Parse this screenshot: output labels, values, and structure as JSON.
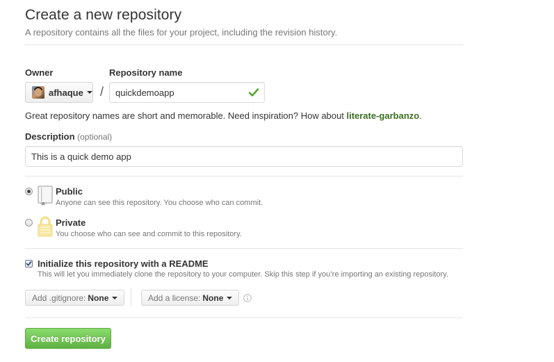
{
  "header": {
    "title": "Create a new repository",
    "subtitle": "A repository contains all the files for your project, including the revision history."
  },
  "owner": {
    "label": "Owner",
    "name": "afhaque"
  },
  "separator": "/",
  "repo_name": {
    "label": "Repository name",
    "value": "quickdemoapp",
    "valid_icon": "check-icon"
  },
  "hint": {
    "text": "Great repository names are short and memorable. Need inspiration? How about ",
    "suggestion": "literate-garbanzo",
    "end": "."
  },
  "description": {
    "label": "Description",
    "optional": "(optional)",
    "value": "This is a quick demo app"
  },
  "visibility": {
    "selected": "public",
    "public": {
      "title": "Public",
      "desc": "Anyone can see this repository. You choose who can commit.",
      "icon": "repo-book-icon"
    },
    "private": {
      "title": "Private",
      "desc": "You choose who can see and commit to this repository.",
      "icon": "lock-icon"
    }
  },
  "readme": {
    "checked": true,
    "title": "Initialize this repository with a README",
    "desc": "This will let you immediately clone the repository to your computer. Skip this step if you’re importing an existing repository."
  },
  "gitignore": {
    "label": "Add .gitignore:",
    "value": "None"
  },
  "license": {
    "label": "Add a license:",
    "value": "None"
  },
  "submit": {
    "label": "Create repository"
  },
  "colors": {
    "accent_green": "#60b044",
    "suggestion_green": "#3b6e22",
    "valid_check": "#55a532",
    "lock_yellow": "#f3dd8b"
  }
}
